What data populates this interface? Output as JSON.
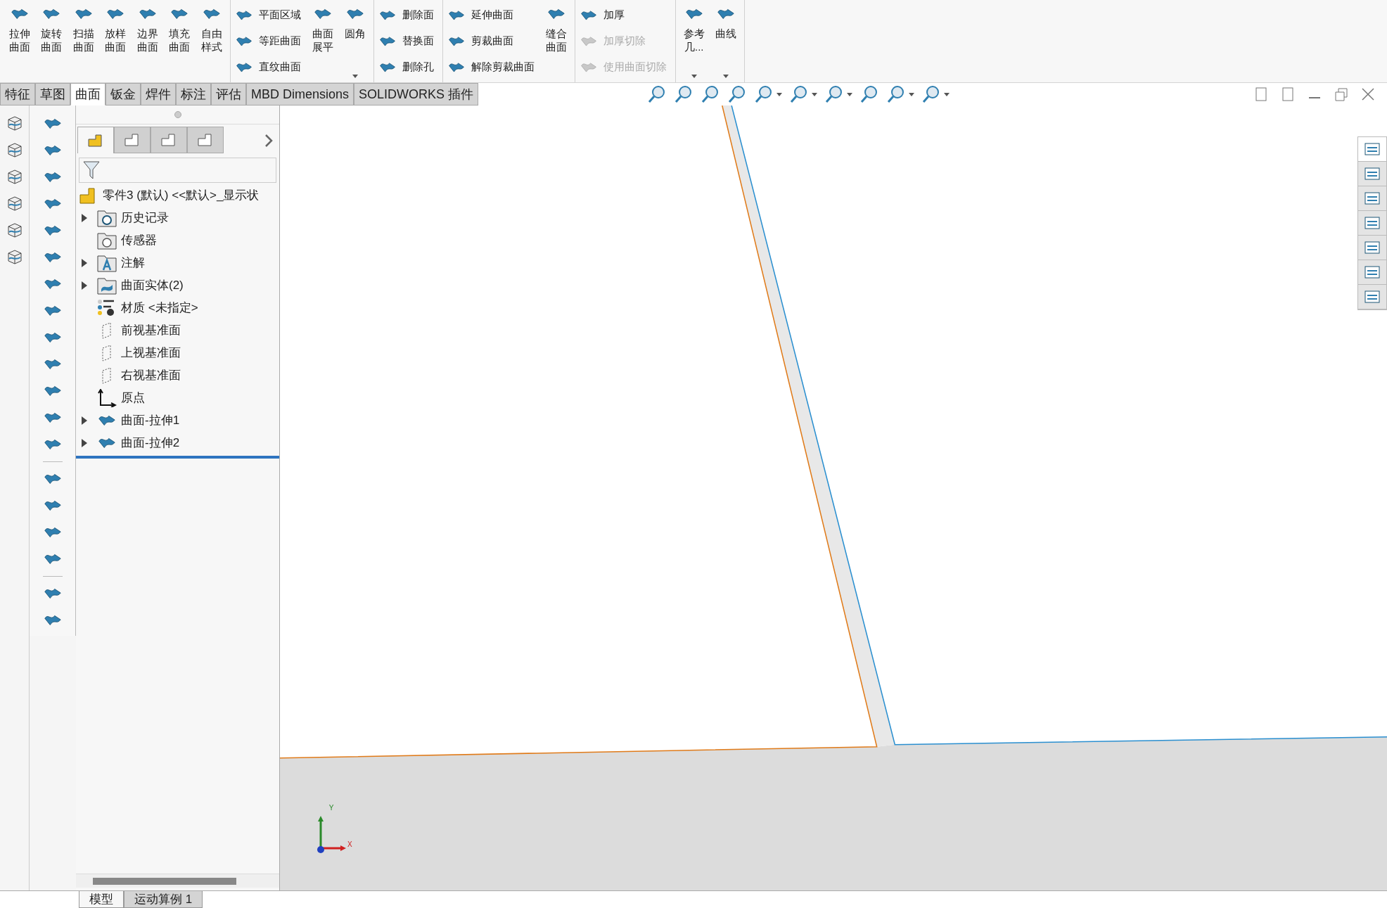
{
  "ribbon": {
    "groups": [
      {
        "columns": [
          {
            "kind": "large",
            "items": [
              {
                "label": "拉伸曲面",
                "disabled": false
              }
            ]
          },
          {
            "kind": "large",
            "items": [
              {
                "label": "旋转曲面",
                "disabled": false
              }
            ]
          },
          {
            "kind": "large",
            "items": [
              {
                "label": "扫描曲面",
                "disabled": false
              }
            ]
          },
          {
            "kind": "large",
            "items": [
              {
                "label": "放样曲面",
                "disabled": false
              }
            ]
          },
          {
            "kind": "large",
            "items": [
              {
                "label": "边界曲面",
                "disabled": false
              }
            ]
          },
          {
            "kind": "large",
            "items": [
              {
                "label": "填充曲面",
                "disabled": false
              }
            ]
          },
          {
            "kind": "large",
            "items": [
              {
                "label": "自由样式",
                "disabled": false
              }
            ]
          }
        ]
      },
      {
        "columns": [
          {
            "kind": "stack",
            "items": [
              {
                "label": "平面区域",
                "disabled": false
              },
              {
                "label": "等距曲面",
                "disabled": false
              },
              {
                "label": "直纹曲面",
                "disabled": false
              }
            ]
          },
          {
            "kind": "large",
            "items": [
              {
                "label": "曲面展平",
                "disabled": false
              }
            ]
          },
          {
            "kind": "large",
            "dropdown": true,
            "items": [
              {
                "label": "圆角",
                "disabled": false
              }
            ]
          }
        ]
      },
      {
        "columns": [
          {
            "kind": "stack",
            "items": [
              {
                "label": "删除面",
                "disabled": false
              },
              {
                "label": "替换面",
                "disabled": false
              },
              {
                "label": "删除孔",
                "disabled": false
              }
            ]
          }
        ]
      },
      {
        "columns": [
          {
            "kind": "stack",
            "items": [
              {
                "label": "延伸曲面",
                "disabled": false
              },
              {
                "label": "剪裁曲面",
                "disabled": false
              },
              {
                "label": "解除剪裁曲面",
                "disabled": false
              }
            ]
          },
          {
            "kind": "large",
            "items": [
              {
                "label": "缝合曲面",
                "disabled": false
              }
            ]
          }
        ]
      },
      {
        "columns": [
          {
            "kind": "stack",
            "items": [
              {
                "label": "加厚",
                "disabled": false
              },
              {
                "label": "加厚切除",
                "disabled": true
              },
              {
                "label": "使用曲面切除",
                "disabled": true
              }
            ]
          }
        ]
      },
      {
        "columns": [
          {
            "kind": "large",
            "dropdown": true,
            "items": [
              {
                "label": "参考几...",
                "disabled": false
              }
            ]
          },
          {
            "kind": "large",
            "dropdown": true,
            "items": [
              {
                "label": "曲线",
                "disabled": false
              }
            ]
          }
        ]
      }
    ]
  },
  "tabs": [
    {
      "label": "特征",
      "selected": false
    },
    {
      "label": "草图",
      "selected": false
    },
    {
      "label": "曲面",
      "selected": true
    },
    {
      "label": "钣金",
      "selected": false
    },
    {
      "label": "焊件",
      "selected": false
    },
    {
      "label": "标注",
      "selected": false
    },
    {
      "label": "评估",
      "selected": false
    },
    {
      "label": "MBD Dimensions",
      "selected": false
    },
    {
      "label": "SOLIDWORKS 插件",
      "selected": false
    }
  ],
  "heads_up_toolbar": [
    {
      "dropdown": false
    },
    {
      "dropdown": false
    },
    {
      "dropdown": false
    },
    {
      "dropdown": false
    },
    {
      "dropdown": true
    },
    {
      "dropdown": true
    },
    {
      "dropdown": true
    },
    {
      "dropdown": false
    },
    {
      "dropdown": true
    },
    {
      "dropdown": true
    }
  ],
  "panel_tabs": [
    {
      "selected": true
    },
    {
      "selected": false
    },
    {
      "selected": false
    },
    {
      "selected": false
    }
  ],
  "feature_tree": {
    "root": "零件3 (默认) <<默认>_显示状",
    "items": [
      {
        "label": "历史记录",
        "kind": "history",
        "expandable": true
      },
      {
        "label": "传感器",
        "kind": "sensor",
        "expandable": false
      },
      {
        "label": "注解",
        "kind": "annotation",
        "expandable": true
      },
      {
        "label": "曲面实体(2)",
        "kind": "bodies",
        "expandable": true
      },
      {
        "label": "材质 <未指定>",
        "kind": "material",
        "expandable": false
      },
      {
        "label": "前视基准面",
        "kind": "plane",
        "expandable": false
      },
      {
        "label": "上视基准面",
        "kind": "plane",
        "expandable": false
      },
      {
        "label": "右视基准面",
        "kind": "plane",
        "expandable": false
      },
      {
        "label": "原点",
        "kind": "origin",
        "expandable": false
      },
      {
        "label": "曲面-拉伸1",
        "kind": "feature",
        "expandable": true
      },
      {
        "label": "曲面-拉伸2",
        "kind": "feature",
        "expandable": true
      }
    ]
  },
  "task_pane": [
    {
      "selected": true
    },
    {
      "selected": false
    },
    {
      "selected": false
    },
    {
      "selected": false
    },
    {
      "selected": false
    },
    {
      "selected": false
    },
    {
      "selected": false
    }
  ],
  "triad": {
    "y_label": "Y",
    "x_label": "X"
  },
  "bottom_tabs": [
    {
      "label": "模型",
      "selected": true
    },
    {
      "label": "运动算例 1",
      "selected": false
    }
  ]
}
